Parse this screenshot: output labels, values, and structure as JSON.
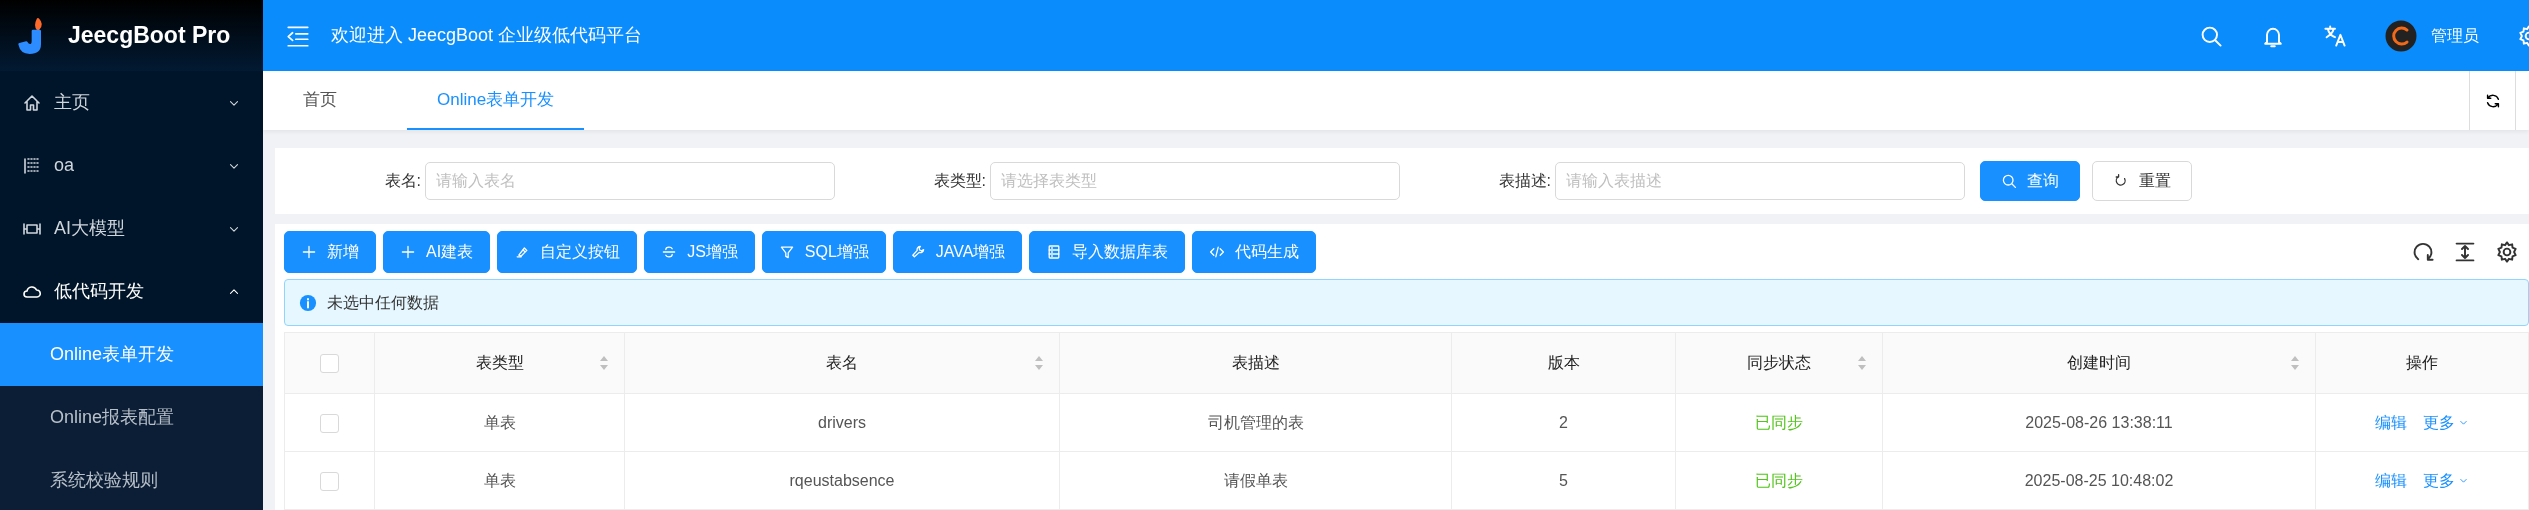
{
  "app": {
    "title": "JeecgBoot Pro"
  },
  "sidebar": {
    "items": [
      {
        "label": "主页",
        "expanded": false
      },
      {
        "label": "oa",
        "expanded": false
      },
      {
        "label": "AI大模型",
        "expanded": false
      },
      {
        "label": "低代码开发",
        "expanded": true,
        "children": [
          {
            "label": "Online表单开发",
            "selected": true
          },
          {
            "label": "Online报表配置",
            "selected": false
          },
          {
            "label": "系统校验规则",
            "selected": false
          }
        ]
      }
    ]
  },
  "header": {
    "welcome": "欢迎进入 JeecgBoot 企业级低代码平台",
    "user": "管理员"
  },
  "tabs": [
    {
      "label": "首页",
      "selected": false
    },
    {
      "label": "Online表单开发",
      "selected": true
    }
  ],
  "search": {
    "fields": [
      {
        "label": "表名:",
        "placeholder": "请输入表名"
      },
      {
        "label": "表类型:",
        "placeholder": "请选择表类型"
      },
      {
        "label": "表描述:",
        "placeholder": "请输入表描述"
      }
    ],
    "buttons": [
      {
        "label": "查询",
        "kind": "primary"
      },
      {
        "label": "重置",
        "kind": "default"
      }
    ]
  },
  "toolbar": {
    "buttons": [
      "新增",
      "AI建表",
      "自定义按钮",
      "JS增强",
      "SQL增强",
      "JAVA增强",
      "导入数据库表",
      "代码生成"
    ]
  },
  "alert": "未选中任何数据",
  "table": {
    "select_all": false,
    "columns": [
      {
        "label": "表类型",
        "sortable": true
      },
      {
        "label": "表名",
        "sortable": true
      },
      {
        "label": "表描述",
        "sortable": false
      },
      {
        "label": "版本",
        "sortable": false
      },
      {
        "label": "同步状态",
        "sortable": true
      },
      {
        "label": "创建时间",
        "sortable": true
      },
      {
        "label": "操作",
        "sortable": false
      }
    ],
    "rows": [
      {
        "checked": false,
        "cells": [
          "单表",
          "drivers",
          "司机管理的表",
          "2",
          "已同步",
          "2025-08-26 13:38:11"
        ],
        "actions": [
          "编辑",
          "更多"
        ]
      },
      {
        "checked": false,
        "cells": [
          "单表",
          "rqeustabsence",
          "请假单表",
          "5",
          "已同步",
          "2025-08-25 10:48:02"
        ],
        "actions": [
          "编辑",
          "更多"
        ]
      }
    ]
  }
}
